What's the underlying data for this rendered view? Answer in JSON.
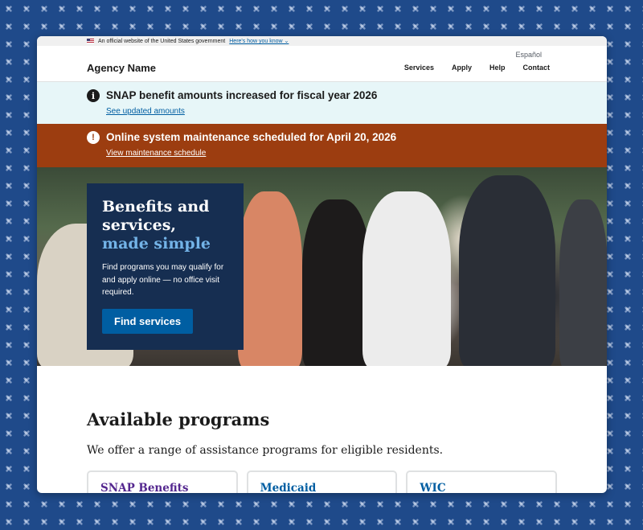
{
  "gov_banner": {
    "text": "An official website of the United States government",
    "link": "Here's how you know ⌄"
  },
  "header": {
    "language_link": "Español",
    "agency_name": "Agency Name",
    "nav": [
      "Services",
      "Apply",
      "Help",
      "Contact"
    ]
  },
  "alerts": [
    {
      "type": "info",
      "icon": "info-icon",
      "title": "SNAP benefit amounts increased for fiscal year 2026",
      "link": "See updated amounts"
    },
    {
      "type": "warning",
      "icon": "alert-icon",
      "title": "Online system maintenance scheduled for April 20, 2026",
      "link": "View maintenance schedule"
    }
  ],
  "hero": {
    "title_line1": "Benefits and",
    "title_line2": "services,",
    "title_accent": "made simple",
    "description": "Find programs you may qualify for and apply online — no office visit required.",
    "button": "Find services"
  },
  "programs": {
    "heading": "Available programs",
    "intro": "We offer a range of assistance programs for eligible residents.",
    "cards": [
      "SNAP Benefits",
      "Medicaid",
      "WIC"
    ]
  },
  "colors": {
    "primary": "#005ea2",
    "hero_card": "#162e51",
    "info_alert": "#e7f6f8",
    "warning_alert": "#9c3d10",
    "accent_light": "#73b3e7"
  }
}
